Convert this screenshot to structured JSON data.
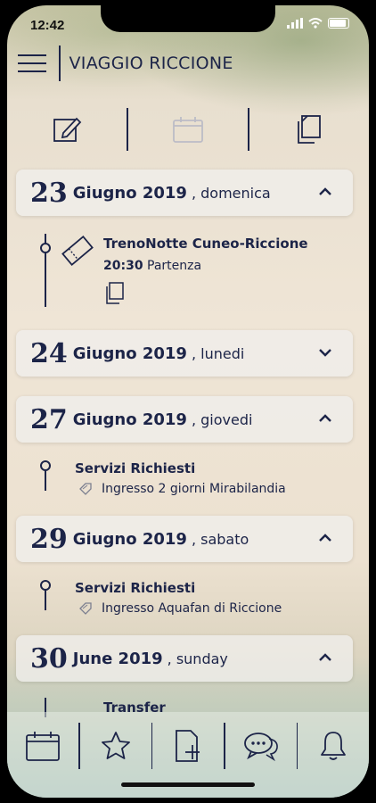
{
  "status": {
    "time": "12:42"
  },
  "header": {
    "title": "VIAGGIO RICCIONE"
  },
  "days": [
    {
      "day": "23",
      "month_year": "Giugno 2019",
      "weekday": ", domenica",
      "expanded": true,
      "events": [
        {
          "title": "TrenoNotte Cuneo-Riccione",
          "time": "20:30",
          "subtitle": "Partenza"
        }
      ]
    },
    {
      "day": "24",
      "month_year": "Giugno 2019",
      "weekday": ", lunedi",
      "expanded": false
    },
    {
      "day": "27",
      "month_year": "Giugno 2019",
      "weekday": ", giovedi",
      "expanded": true,
      "events": [
        {
          "title": "Servizi Richiesti",
          "subtitle": "Ingresso 2 giorni Mirabilandia"
        }
      ]
    },
    {
      "day": "29",
      "month_year": "Giugno 2019",
      "weekday": ", sabato",
      "expanded": true,
      "events": [
        {
          "title": "Servizi Richiesti",
          "subtitle": "Ingresso Aquafan di Riccione"
        }
      ]
    },
    {
      "day": "30",
      "month_year": "June 2019",
      "weekday": ", sunday",
      "expanded": true,
      "events": [
        {
          "title": "Transfer"
        }
      ]
    }
  ],
  "icons": {
    "toolbar": [
      "edit-icon",
      "calendar-icon",
      "document-icon"
    ],
    "tabbar": [
      "calendar-icon",
      "star-icon",
      "add-document-icon",
      "chat-icon",
      "bell-icon"
    ]
  },
  "colors": {
    "ink": "#1c2448",
    "card": "#f0eeec"
  }
}
